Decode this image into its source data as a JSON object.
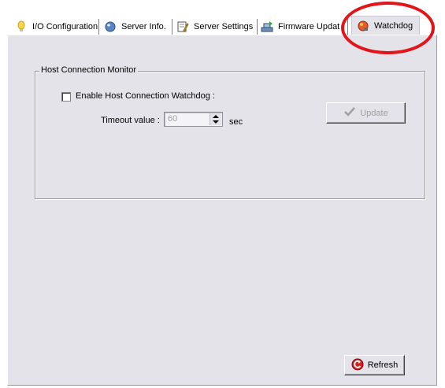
{
  "tabs": [
    {
      "label": "I/O Configuration",
      "icon": "lightbulb-icon"
    },
    {
      "label": "Server Info.",
      "icon": "info-globe-icon"
    },
    {
      "label": "Server Settings",
      "icon": "settings-edit-icon"
    },
    {
      "label": "Firmware Updat",
      "icon": "firmware-update-icon"
    },
    {
      "label": "Watchdog",
      "icon": "watchdog-icon",
      "active": true
    }
  ],
  "group": {
    "title": "Host Connection Monitor"
  },
  "enable_watchdog": {
    "label": "Enable Host Connection Watchdog :",
    "checked": false
  },
  "timeout": {
    "label": "Timeout value :",
    "value": "60",
    "unit": "sec"
  },
  "buttons": {
    "update": "Update",
    "refresh": "Refresh"
  },
  "colors": {
    "panel_bg": "#e4e3e9",
    "annotation": "#e0161b",
    "disabled_text": "#a0a0a0"
  }
}
